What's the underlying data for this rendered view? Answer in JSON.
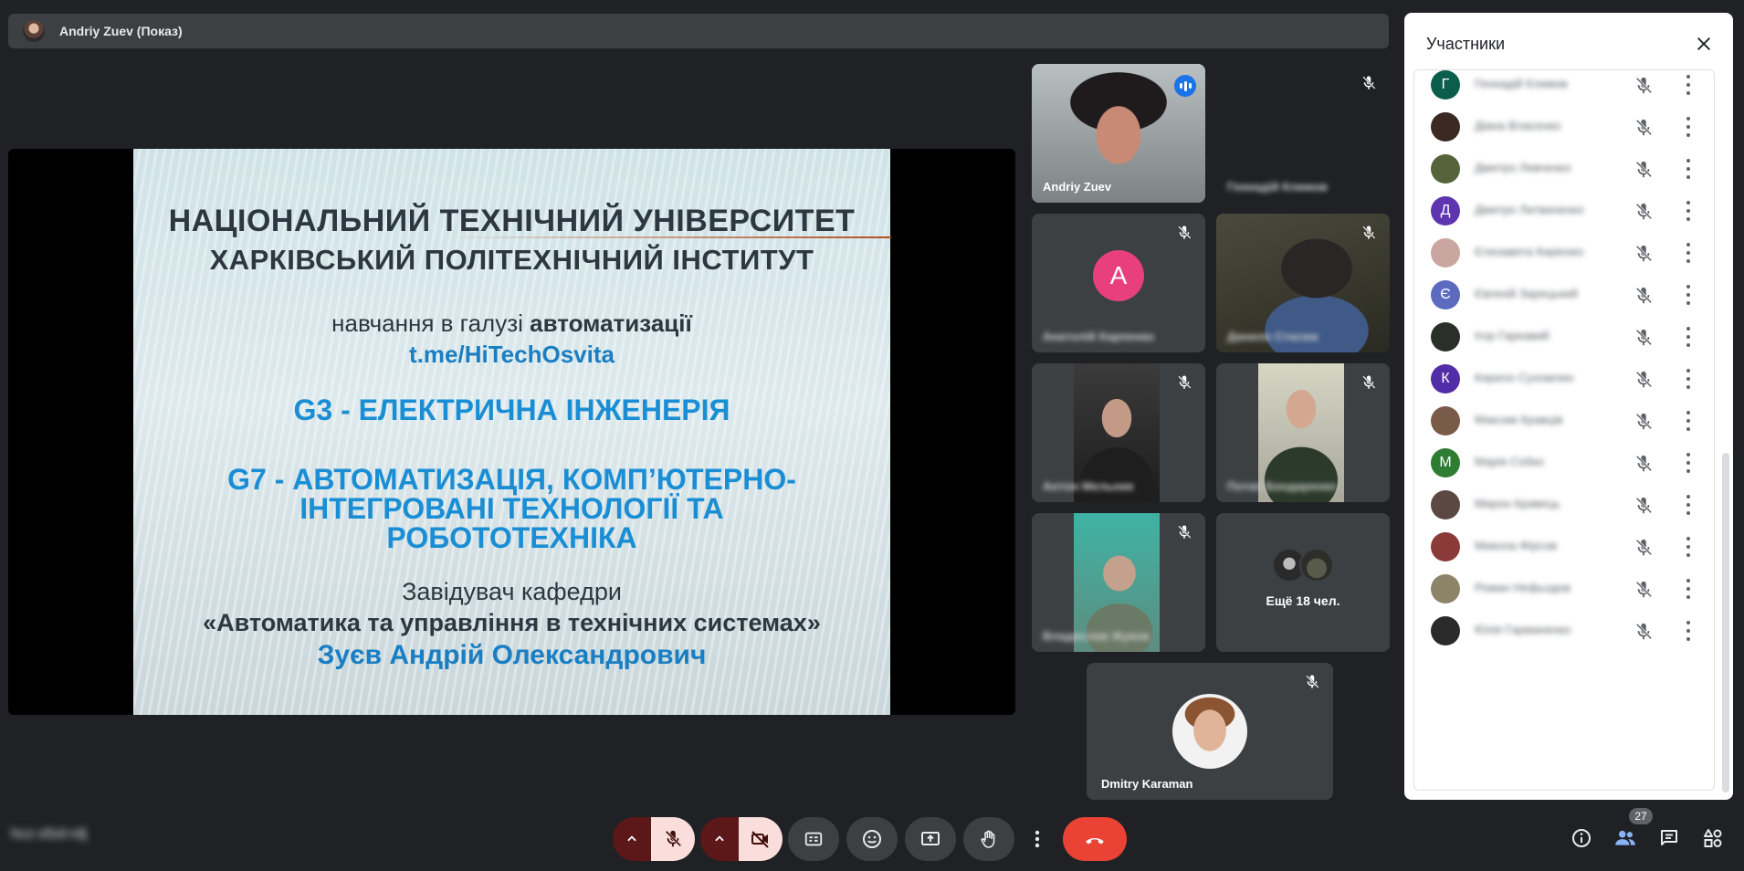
{
  "presenter": {
    "name": "Andriy Zuev (Показ)"
  },
  "slide": {
    "line1": "НАЦІОНАЛЬНИЙ ТЕХНІЧНИЙ УНІВЕРСИТЕТ",
    "line2": "ХАРКІВСЬКИЙ ПОЛІТЕХНІЧНИЙ ІНСТИТУТ",
    "study_prefix": "навчання в галузі ",
    "study_bold": "автоматизації",
    "link": "t.me/HiTechOsvita",
    "g3": "G3 - ЕЛЕКТРИЧНА ІНЖЕНЕРІЯ",
    "g7_line1": "G7 - АВТОМАТИЗАЦІЯ, КОМП’ЮТЕРНО-",
    "g7_line2": "ІНТЕГРОВАНІ ТЕХНОЛОГІЇ ТА",
    "g7_line3": "РОБОТОТЕХНІКА",
    "head": "Завідувач кафедри",
    "dept": "«Автоматика та управління в технічних системах»",
    "person": "Зуєв Андрій Олександрович"
  },
  "tiles": {
    "zuev": {
      "name": "Andriy Zuev"
    },
    "hidden2": {
      "name": "Геннадій Климов"
    },
    "letter_a": {
      "letter": "A",
      "name": "Анатолій Карпенко"
    },
    "cam4": {
      "name": "Данило Стасюк"
    },
    "cam5": {
      "name": "Антон Мельник"
    },
    "cam6": {
      "name": "Потап Бондаренко"
    },
    "cam7": {
      "name": "Владислав Жуков"
    },
    "more": {
      "label": "Ещё 18 чел."
    },
    "karaman": {
      "name": "Dmitry Karaman"
    }
  },
  "panel": {
    "title": "Участники",
    "participants": [
      {
        "letter": "Г",
        "name": "Геннадій Климов",
        "color": "#0b5e4c"
      },
      {
        "letter": "",
        "name": "Діана Власенко",
        "color": "#3a2a22"
      },
      {
        "letter": "",
        "name": "Дмитро Левченко",
        "color": "#55633a"
      },
      {
        "letter": "Д",
        "name": "Дмитро Литвиненко",
        "color": "#5e35b1"
      },
      {
        "letter": "",
        "name": "Єлизавета Кирієнко",
        "color": "#c9a7a0"
      },
      {
        "letter": "Є",
        "name": "Євгеній Зарецький",
        "color": "#5c6bc0"
      },
      {
        "letter": "",
        "name": "Ігор Гаркавий",
        "color": "#2b2f2a"
      },
      {
        "letter": "К",
        "name": "Кирило Сухомлин",
        "color": "#512da8"
      },
      {
        "letter": "",
        "name": "Максим Кравців",
        "color": "#7a5a48"
      },
      {
        "letter": "М",
        "name": "Марія Собко",
        "color": "#2e7d32"
      },
      {
        "letter": "",
        "name": "Мирон Кривець",
        "color": "#5b4842"
      },
      {
        "letter": "",
        "name": "Микола Фірсов",
        "color": "#8b3a3a"
      },
      {
        "letter": "",
        "name": "Роман Нефьодов",
        "color": "#8d8468"
      },
      {
        "letter": "",
        "name": "Юлія Гарманенко",
        "color": "#2a2a2a"
      }
    ]
  },
  "bottom": {
    "meeting_code": "hcz-xfzd-rdj",
    "people_count": "27"
  },
  "colors": {
    "accent": "#8ab4f8",
    "end_call": "#ea4335",
    "mic_off_bg": "#f9dedc",
    "mic_arrow_bg": "#5c1818"
  }
}
